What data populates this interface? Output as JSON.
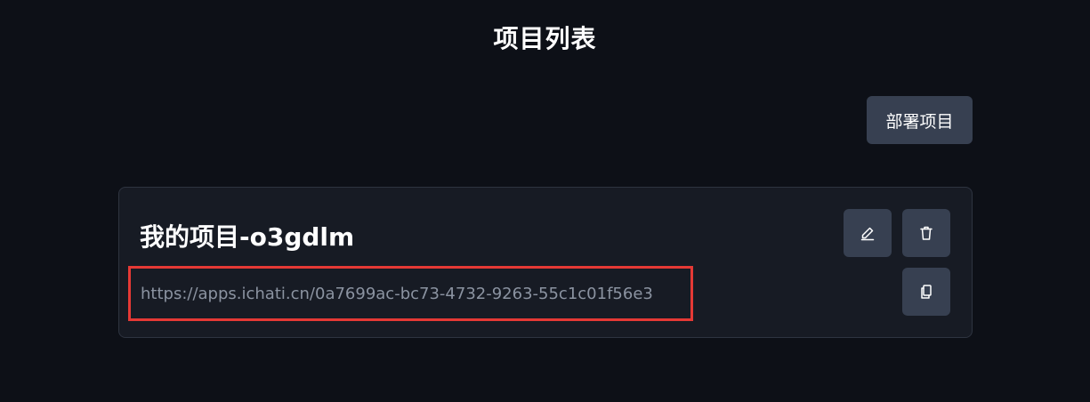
{
  "header": {
    "title": "项目列表"
  },
  "toolbar": {
    "deploy_label": "部署项目"
  },
  "project": {
    "name": "我的项目-o3gdlm",
    "url": "https://apps.ichati.cn/0a7699ac-bc73-4732-9263-55c1c01f56e3"
  },
  "icons": {
    "edit": "pencil-icon",
    "delete": "trash-icon",
    "copy": "copy-icon"
  },
  "colors": {
    "background": "#0d1017",
    "card": "#171b24",
    "button": "#374051",
    "highlight": "#e53935"
  }
}
